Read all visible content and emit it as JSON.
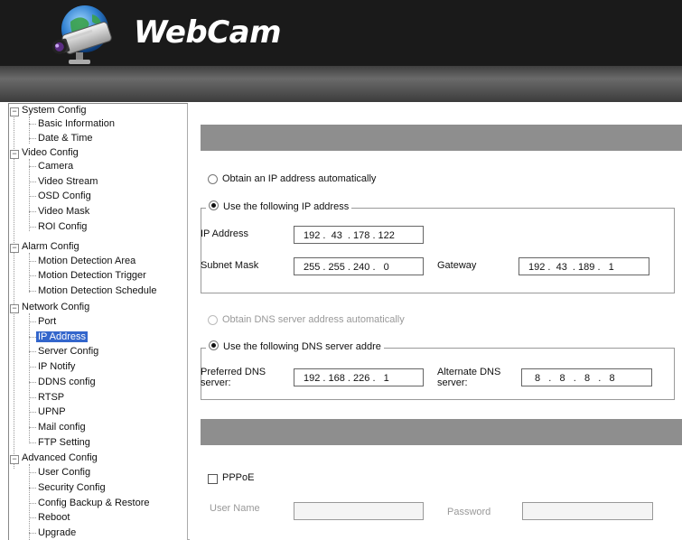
{
  "header": {
    "logo_text": "WebCam"
  },
  "sidebar": {
    "system_config": "System Config",
    "basic_information": "Basic Information",
    "date_time": "Date & Time",
    "video_config": "Video Config",
    "camera": "Camera",
    "video_stream": "Video Stream",
    "osd_config": "OSD Config",
    "video_mask": "Video Mask",
    "roi_config": "ROI Config",
    "alarm_config": "Alarm Config",
    "motion_detection_area": "Motion Detection Area",
    "motion_detection_trigger": "Motion Detection Trigger",
    "motion_detection_schedule": "Motion Detection Schedule",
    "network_config": "Network Config",
    "port": "Port",
    "ip_address": "IP Address",
    "server_config": "Server Config",
    "ip_notify": "IP Notify",
    "ddns_config": "DDNS config",
    "rtsp": "RTSP",
    "upnp": "UPNP",
    "mail_config": "Mail config",
    "ftp_setting": "FTP Setting",
    "advanced_config": "Advanced Config",
    "user_config": "User Config",
    "security_config": "Security Config",
    "config_backup_restore": "Config Backup & Restore",
    "reboot": "Reboot",
    "upgrade": "Upgrade"
  },
  "ip_section": {
    "obtain_auto_label": "Obtain an IP address automatically",
    "use_following_label": "Use the following IP address",
    "ip_address_label": "IP Address",
    "ip_address_value": "192 .  43  . 178 . 122",
    "subnet_mask_label": "Subnet Mask",
    "subnet_mask_value": "255 . 255 . 240 .   0",
    "gateway_label": "Gateway",
    "gateway_value": "192 .  43  . 189 .   1"
  },
  "dns_section": {
    "obtain_auto_label": "Obtain DNS server address automatically",
    "use_following_label": "Use the following DNS server addre",
    "preferred_label_1": "Preferred DNS",
    "preferred_label_2": "server:",
    "preferred_value": "192 . 168 . 226 .   1",
    "alternate_label_1": "Alternate DNS",
    "alternate_label_2": "server:",
    "alternate_value": "8   .   8   .   8   .   8"
  },
  "pppoe_section": {
    "pppoe_label": "PPPoE",
    "user_name_label": "User Name",
    "user_name_value": "",
    "password_label": "Password",
    "password_value": ""
  },
  "colors": {
    "selected": "#3366cc",
    "bar": "#8e8e8e",
    "header": "#1a1a1a"
  }
}
